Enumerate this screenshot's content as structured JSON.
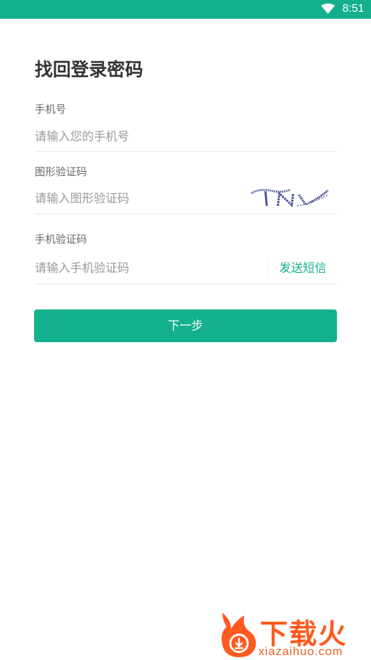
{
  "status_bar": {
    "time": "8:51",
    "wifi_icon": "wifi-icon"
  },
  "page": {
    "title": "找回登录密码"
  },
  "fields": {
    "phone": {
      "label": "手机号",
      "placeholder": "请输入您的手机号"
    },
    "captcha": {
      "label": "图形验证码",
      "placeholder": "请输入图形验证码",
      "image_text": "TNW"
    },
    "sms_code": {
      "label": "手机验证码",
      "placeholder": "请输入手机验证码",
      "send_label": "发送短信"
    }
  },
  "actions": {
    "next_label": "下一步"
  },
  "watermark": {
    "brand": "下载火",
    "domain": "xiazaihuo.com"
  },
  "colors": {
    "accent": "#14b08e",
    "watermark": "#ff5a1f"
  }
}
